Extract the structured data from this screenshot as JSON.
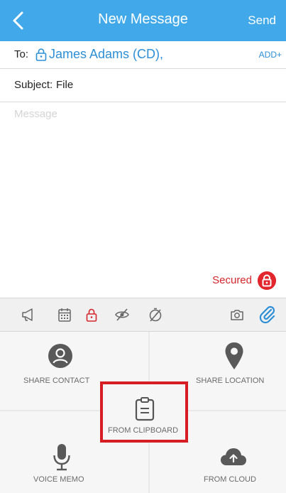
{
  "header": {
    "back_icon": "chevron-left-icon",
    "title": "New Message",
    "send_label": "Send"
  },
  "recipients": {
    "to_label": "To:",
    "lock_icon": "lock-icon",
    "recipient": "James Adams (CD),",
    "add_label": "ADD+"
  },
  "subject": {
    "label": "Subject:",
    "value": "File"
  },
  "message": {
    "placeholder": "Message"
  },
  "security": {
    "label": "Secured",
    "icon": "lock-icon",
    "color": "#e1262d"
  },
  "toolbar": {
    "icons": [
      "megaphone-icon",
      "calendar-icon",
      "lock-icon",
      "eye-off-icon",
      "timer-off-icon",
      "camera-icon",
      "paperclip-icon"
    ]
  },
  "attachments": {
    "share_contact": "SHARE CONTACT",
    "share_location": "SHARE LOCATION",
    "from_clipboard": "FROM CLIPBOARD",
    "voice_memo": "VOICE MEMO",
    "from_cloud": "FROM CLOUD"
  },
  "colors": {
    "header_bg": "#41a9ea",
    "link": "#2d8fd6",
    "highlight": "#d71d24"
  }
}
